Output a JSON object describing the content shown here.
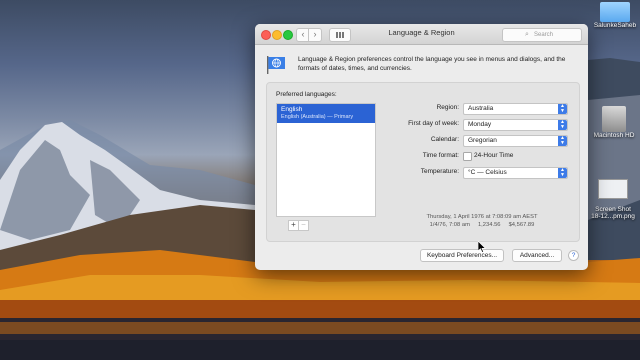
{
  "window": {
    "title": "Language & Region",
    "search_placeholder": "Search",
    "description": "Language & Region preferences control the language you see in menus and dialogs, and the formats of dates, times, and currencies."
  },
  "preferred_languages": {
    "label": "Preferred languages:",
    "items": [
      {
        "name": "English",
        "detail": "English (Australia) — Primary"
      }
    ],
    "add": "+",
    "remove": "−"
  },
  "settings": {
    "region_label": "Region:",
    "region_value": "Australia",
    "first_day_label": "First day of week:",
    "first_day_value": "Monday",
    "calendar_label": "Calendar:",
    "calendar_value": "Gregorian",
    "time_format_label": "Time format:",
    "time_format_option": "24-Hour Time",
    "temperature_label": "Temperature:",
    "temperature_value": "°C — Celsius"
  },
  "sample": {
    "line1": "Thursday, 1 April 1976 at 7:08:09 am AEST",
    "line2": "1/4/76, 7:08 am     1,234.56     $4,567.89"
  },
  "buttons": {
    "keyboard_prefs": "Keyboard Preferences...",
    "advanced": "Advanced...",
    "help": "?"
  },
  "desktop": {
    "icons": [
      {
        "label": "SalunkeSaheb"
      },
      {
        "label": "Macintosh HD"
      },
      {
        "label": "Screen Shot\n18-12...pm.png"
      }
    ]
  }
}
